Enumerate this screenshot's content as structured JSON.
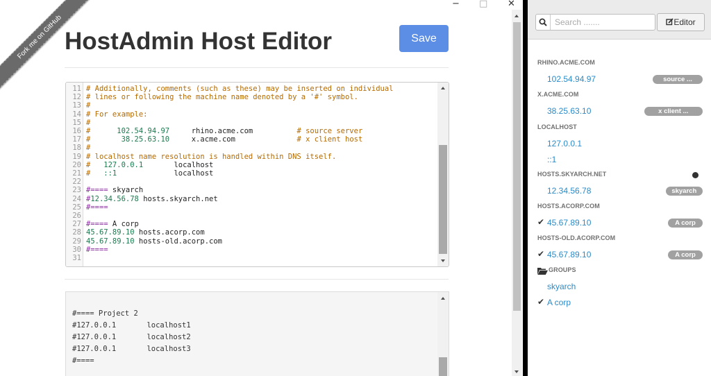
{
  "window": {
    "minimize": "−",
    "maximize": "□",
    "close": "✕"
  },
  "ribbon": "Fork me on GitHub",
  "page": {
    "title": "HostAdmin Host Editor",
    "save_label": "Save"
  },
  "editor1": {
    "lines": [
      {
        "n": "11",
        "parts": [
          {
            "t": "# Additionally, comments (such as these) may be inserted on individual",
            "c": "com"
          }
        ]
      },
      {
        "n": "12",
        "parts": [
          {
            "t": "# lines or following the machine name denoted by a '#' symbol.",
            "c": "com"
          }
        ]
      },
      {
        "n": "13",
        "parts": [
          {
            "t": "#",
            "c": "com"
          }
        ]
      },
      {
        "n": "14",
        "parts": [
          {
            "t": "# For example:",
            "c": "com"
          }
        ]
      },
      {
        "n": "15",
        "parts": [
          {
            "t": "#",
            "c": "com"
          }
        ]
      },
      {
        "n": "16",
        "parts": [
          {
            "t": "#",
            "c": "com"
          },
          {
            "t": "      102.54.94.97",
            "c": "num"
          },
          {
            "t": "     rhino.acme.com",
            "c": "host"
          },
          {
            "t": "          # source server",
            "c": "com"
          }
        ]
      },
      {
        "n": "17",
        "parts": [
          {
            "t": "#",
            "c": "com"
          },
          {
            "t": "       38.25.63.10",
            "c": "num"
          },
          {
            "t": "     x.acme.com",
            "c": "host"
          },
          {
            "t": "              # x client host",
            "c": "com"
          }
        ]
      },
      {
        "n": "18",
        "parts": [
          {
            "t": "#",
            "c": "com"
          }
        ]
      },
      {
        "n": "19",
        "parts": [
          {
            "t": "# localhost name resolution is handled within DNS itself.",
            "c": "com"
          }
        ]
      },
      {
        "n": "20",
        "parts": [
          {
            "t": "#",
            "c": "com"
          },
          {
            "t": "   127.0.0.1",
            "c": "num"
          },
          {
            "t": "       localhost",
            "c": "host"
          }
        ]
      },
      {
        "n": "21",
        "parts": [
          {
            "t": "#",
            "c": "com"
          },
          {
            "t": "   ::1",
            "c": "num"
          },
          {
            "t": "             localhost",
            "c": "host"
          }
        ]
      },
      {
        "n": "22",
        "parts": []
      },
      {
        "n": "23",
        "parts": [
          {
            "t": "#====",
            "c": "hash"
          },
          {
            "t": " skyarch",
            "c": "host"
          }
        ]
      },
      {
        "n": "24",
        "parts": [
          {
            "t": "#",
            "c": "hash"
          },
          {
            "t": "12.34.56.78",
            "c": "num"
          },
          {
            "t": " hosts.skyarch.net",
            "c": "host"
          }
        ]
      },
      {
        "n": "25",
        "parts": [
          {
            "t": "#====",
            "c": "hash"
          }
        ]
      },
      {
        "n": "26",
        "parts": []
      },
      {
        "n": "27",
        "parts": [
          {
            "t": "#====",
            "c": "hash"
          },
          {
            "t": " A corp",
            "c": "host"
          }
        ]
      },
      {
        "n": "28",
        "parts": [
          {
            "t": "45.67.89.10",
            "c": "num"
          },
          {
            "t": " hosts.acorp.com",
            "c": "host"
          }
        ]
      },
      {
        "n": "29",
        "parts": [
          {
            "t": "45.67.89.10",
            "c": "num"
          },
          {
            "t": " hosts-old.acorp.com",
            "c": "host"
          }
        ]
      },
      {
        "n": "30",
        "parts": [
          {
            "t": "#====",
            "c": "hash"
          }
        ]
      },
      {
        "n": "31",
        "parts": []
      }
    ]
  },
  "editor2": {
    "lines": [
      "#==== Project 2",
      "#127.0.0.1       localhost1",
      "#127.0.0.1       localhost2",
      "#127.0.0.1       localhost3",
      "#===="
    ]
  },
  "sidebar": {
    "search_placeholder": "Search .......",
    "editor_label": "Editor",
    "entries": [
      {
        "type": "section",
        "label": "RHINO.ACME.COM"
      },
      {
        "type": "ip",
        "ip": "102.54.94.97",
        "badge": "source ...",
        "checked": false
      },
      {
        "type": "section",
        "label": "X.ACME.COM"
      },
      {
        "type": "ip",
        "ip": "38.25.63.10",
        "badge": "x client ...",
        "checked": false
      },
      {
        "type": "section",
        "label": "LOCALHOST"
      },
      {
        "type": "ip",
        "ip": "127.0.0.1",
        "badge": "",
        "checked": false
      },
      {
        "type": "ip",
        "ip": "::1",
        "badge": "",
        "checked": false
      },
      {
        "type": "section",
        "label": "HOSTS.SKYARCH.NET",
        "icon": "globe-icon"
      },
      {
        "type": "ip",
        "ip": "12.34.56.78",
        "badge": "skyarch",
        "checked": false
      },
      {
        "type": "section",
        "label": "HOSTS.ACORP.COM"
      },
      {
        "type": "ip",
        "ip": "45.67.89.10",
        "badge": "A corp",
        "checked": true
      },
      {
        "type": "section",
        "label": "HOSTS-OLD.ACORP.COM"
      },
      {
        "type": "ip",
        "ip": "45.67.89.10",
        "badge": "A corp",
        "checked": true
      },
      {
        "type": "group-header",
        "label": "GROUPS",
        "icon": "folder-open-icon"
      },
      {
        "type": "group",
        "label": "skyarch",
        "checked": false
      },
      {
        "type": "group",
        "label": "A corp",
        "checked": true
      }
    ]
  },
  "colors": {
    "accent": "#5b8ee4",
    "link": "#2a8bc8",
    "badge": "#a1a1a1",
    "comment": "#b56a00",
    "hash": "#8b2fa0",
    "number": "#1a7a4e"
  }
}
